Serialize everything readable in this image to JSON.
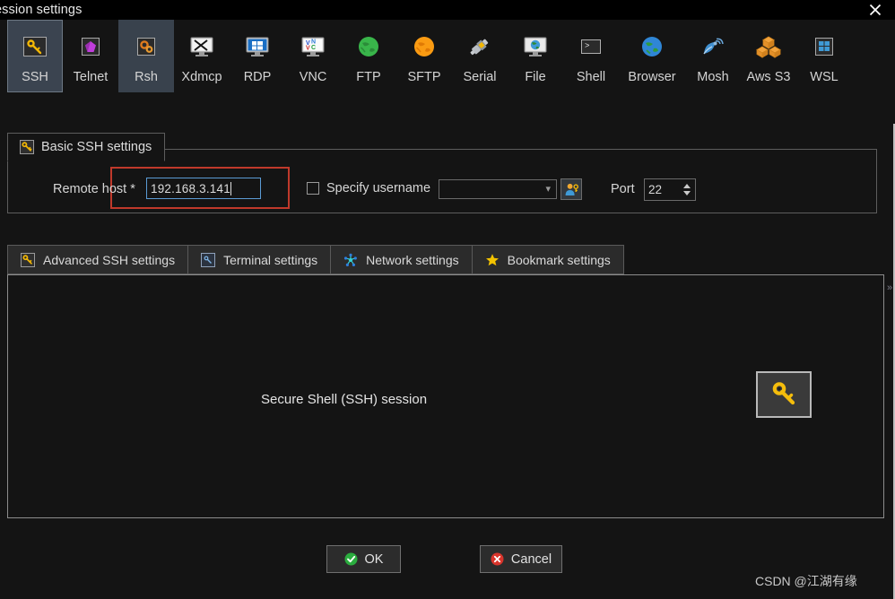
{
  "window": {
    "title": "ession settings",
    "close_icon": "close-icon"
  },
  "protocols": [
    {
      "label": "SSH",
      "icon": "key-icon",
      "selected": true,
      "hover": false
    },
    {
      "label": "Telnet",
      "icon": "gem-icon",
      "selected": false,
      "hover": false
    },
    {
      "label": "Rsh",
      "icon": "gears-icon",
      "selected": false,
      "hover": true
    },
    {
      "label": "Xdmcp",
      "icon": "monitor-x-icon",
      "selected": false,
      "hover": false
    },
    {
      "label": "RDP",
      "icon": "windows-monitor-icon",
      "selected": false,
      "hover": false
    },
    {
      "label": "VNC",
      "icon": "vnc-monitor-icon",
      "selected": false,
      "hover": false
    },
    {
      "label": "FTP",
      "icon": "green-globe-icon",
      "selected": false,
      "hover": false
    },
    {
      "label": "SFTP",
      "icon": "orange-globe-icon",
      "selected": false,
      "hover": false
    },
    {
      "label": "Serial",
      "icon": "serial-plug-icon",
      "selected": false,
      "hover": false
    },
    {
      "label": "File",
      "icon": "globe-monitor-icon",
      "selected": false,
      "hover": false
    },
    {
      "label": "Shell",
      "icon": "terminal-prompt-icon",
      "selected": false,
      "hover": false
    },
    {
      "label": "Browser",
      "icon": "blue-globe-icon",
      "selected": false,
      "hover": false
    },
    {
      "label": "Mosh",
      "icon": "satellite-dish-icon",
      "selected": false,
      "hover": false
    },
    {
      "label": "Aws S3",
      "icon": "aws-cubes-icon",
      "selected": false,
      "hover": false
    },
    {
      "label": "WSL",
      "icon": "windows-square-icon",
      "selected": false,
      "hover": false
    }
  ],
  "basic_group": {
    "tab_label": "Basic SSH settings",
    "tab_icon": "key-icon",
    "remote_host_label": "Remote host *",
    "remote_host_value": "192.168.3.141",
    "specify_username_label": "Specify username",
    "specify_username_checked": false,
    "username_value": "",
    "username_dropdown_icon": "chevron-down-icon",
    "user_button_icon": "user-key-icon",
    "port_label": "Port",
    "port_value": "22",
    "highlight_color": "#c0392b",
    "focus_border_color": "#5b9bd5"
  },
  "tabs": [
    {
      "label": "Advanced SSH settings",
      "icon": "key-icon",
      "active": false
    },
    {
      "label": "Terminal settings",
      "icon": "terminal-icon",
      "active": false
    },
    {
      "label": "Network settings",
      "icon": "network-icon",
      "active": false
    },
    {
      "label": "Bookmark settings",
      "icon": "star-icon",
      "active": false
    }
  ],
  "content": {
    "caption": "Secure Shell (SSH) session",
    "badge_icon": "key-icon",
    "edge_artifact": "»"
  },
  "footer": {
    "ok_label": "OK",
    "ok_icon": "check-circle-icon",
    "cancel_label": "Cancel",
    "cancel_icon": "x-circle-icon"
  },
  "watermark": "CSDN @江湖有缘"
}
